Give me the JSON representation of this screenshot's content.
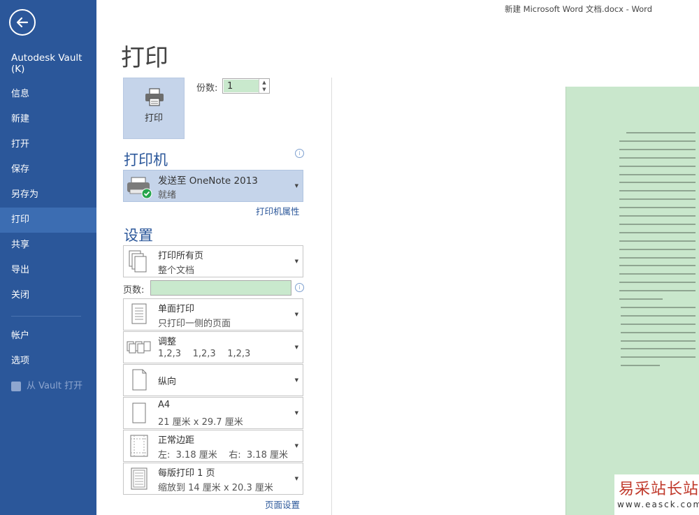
{
  "window": {
    "title": "新建 Microsoft Word 文档.docx - Word"
  },
  "sidebar": {
    "vault_title": "Autodesk Vault (K)",
    "items": [
      {
        "label": "信息"
      },
      {
        "label": "新建"
      },
      {
        "label": "打开"
      },
      {
        "label": "保存"
      },
      {
        "label": "另存为"
      },
      {
        "label": "打印",
        "active": true
      },
      {
        "label": "共享"
      },
      {
        "label": "导出"
      },
      {
        "label": "关闭"
      }
    ],
    "items2": [
      {
        "label": "帐户"
      },
      {
        "label": "选项"
      },
      {
        "label": "从 Vault 打开",
        "disabled": true
      }
    ]
  },
  "main": {
    "heading": "打印",
    "print_button": "打印",
    "copies_label": "份数:",
    "copies_value": "1",
    "printer_heading": "打印机",
    "printer": {
      "name": "发送至 OneNote 2013",
      "status": "就绪"
    },
    "printer_properties": "打印机属性",
    "settings_heading": "设置",
    "pages_label": "页数:",
    "pages_value": "",
    "page_setup": "页面设置",
    "settings": {
      "range": {
        "title": "打印所有页",
        "subtitle": "整个文档"
      },
      "sides": {
        "title": "单面打印",
        "subtitle": "只打印一侧的页面"
      },
      "collate": {
        "title": "调整",
        "subtitle": "1,2,3    1,2,3    1,2,3"
      },
      "orientation": {
        "title": "纵向"
      },
      "paper": {
        "title": "A4",
        "subtitle": "21 厘米 x 29.7 厘米"
      },
      "margins": {
        "title": "正常边距",
        "subtitle": "左:  3.18 厘米    右:  3.18 厘米"
      },
      "pages_per_sheet": {
        "title": "每版打印 1 页",
        "subtitle": "缩放到 14 厘米 x 20.3 厘米"
      }
    }
  },
  "watermark": {
    "text": "易采站长站",
    "url": "www.easck.com"
  },
  "colors": {
    "sidebar": "#2b579a",
    "active": "#3c6db2",
    "preview_page": "#c9e7cc",
    "accent_text": "#2b579a"
  }
}
